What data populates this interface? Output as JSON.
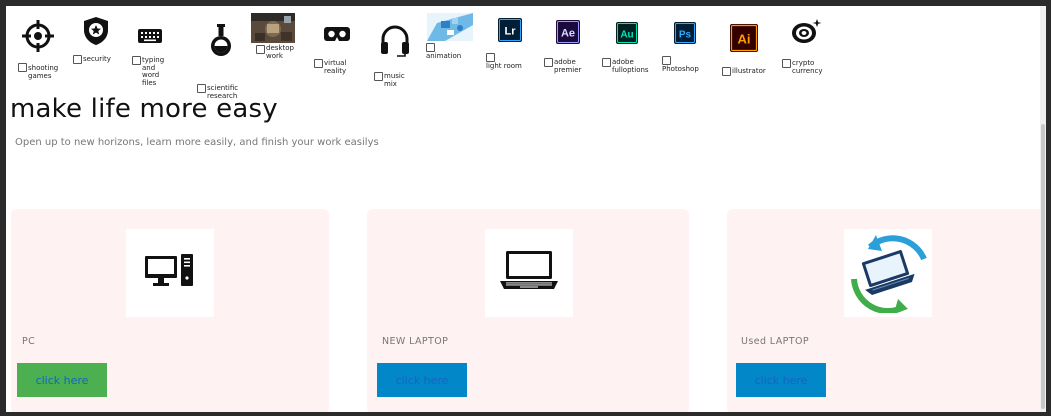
{
  "categories": [
    {
      "label": "shooting games",
      "icon": "crosshair-icon"
    },
    {
      "label": "security",
      "icon": "shield-star-icon"
    },
    {
      "label": "typing and word files",
      "icon": "keyboard-icon"
    },
    {
      "label": "scientific research",
      "icon": "flask-icon"
    },
    {
      "label": "desktop work",
      "icon": "desktop-photo-icon"
    },
    {
      "label": "virtual reality",
      "icon": "vr-headset-icon"
    },
    {
      "label": "music mix",
      "icon": "headphones-icon"
    },
    {
      "label": "animation",
      "icon": "animation-image-icon"
    },
    {
      "label": "light room",
      "icon": "lightroom-icon",
      "badge": "Lr"
    },
    {
      "label": "adobe premier",
      "icon": "after-effects-icon",
      "badge": "Ae"
    },
    {
      "label": "adobe fulloptions",
      "icon": "audition-icon",
      "badge": "Au"
    },
    {
      "label": "Photoshop",
      "icon": "photoshop-icon",
      "badge": "Ps"
    },
    {
      "label": "illustrator",
      "icon": "illustrator-icon",
      "badge": "Ai"
    },
    {
      "label": "crypto currency",
      "icon": "crypto-icon"
    }
  ],
  "hero": {
    "title": "make life more easy",
    "subtitle": "Open up to new horizons, learn more easily, and finish your work easilys"
  },
  "products": [
    {
      "name": "PC",
      "button": "click here",
      "button_color": "#4caf50",
      "icon": "desktop-computer-icon"
    },
    {
      "name": "NEW LAPTOP",
      "button": "click here",
      "button_color": "#0288c8",
      "icon": "laptop-icon"
    },
    {
      "name": "Used LAPTOP",
      "button": "click here",
      "button_color": "#0288c8",
      "icon": "laptop-refresh-icon"
    }
  ],
  "colors": {
    "card_bg": "#fff2f2",
    "green": "#4caf50",
    "blue": "#0288c8",
    "link_text": "#1565c0"
  }
}
